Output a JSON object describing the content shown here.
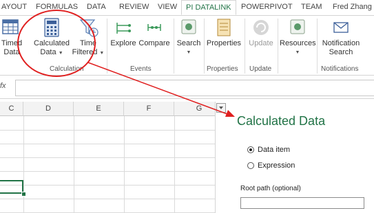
{
  "tabs": [
    {
      "label": "AYOUT"
    },
    {
      "label": "FORMULAS"
    },
    {
      "label": "DATA"
    },
    {
      "label": "REVIEW"
    },
    {
      "label": "VIEW"
    },
    {
      "label": "PI DATALINK"
    },
    {
      "label": "POWERPIVOT"
    },
    {
      "label": "TEAM"
    }
  ],
  "user_name": "Fred Zhang",
  "ribbon": {
    "timed": {
      "line1": "Timed",
      "line2": "Data"
    },
    "calculated": {
      "line1": "Calculated",
      "line2": "Data"
    },
    "time_filtered": {
      "line1": "Time",
      "line2": "Filtered"
    },
    "explore": {
      "label": "Explore"
    },
    "compare": {
      "label": "Compare"
    },
    "search": {
      "label": "Search"
    },
    "properties": {
      "label": "Properties"
    },
    "update": {
      "label": "Update"
    },
    "resources": {
      "label": "Resources"
    },
    "notification": {
      "line1": "Notification",
      "line2": "Search"
    },
    "groups": {
      "calculation": "Calculation",
      "events": "Events",
      "properties": "Properties",
      "update": "Update",
      "notifications": "Notifications"
    }
  },
  "formula_bar": {
    "fx": "fx",
    "value": ""
  },
  "columns": [
    "D",
    "E",
    "F",
    "G"
  ],
  "partial_column": "C",
  "pane": {
    "title": "Calculated Data",
    "radio_data_item": "Data item",
    "radio_expression": "Expression",
    "selected": "Data item",
    "root_path_label": "Root path (optional)",
    "root_path_value": ""
  },
  "colors": {
    "accent": "#217346",
    "annotation": "#e02020"
  }
}
